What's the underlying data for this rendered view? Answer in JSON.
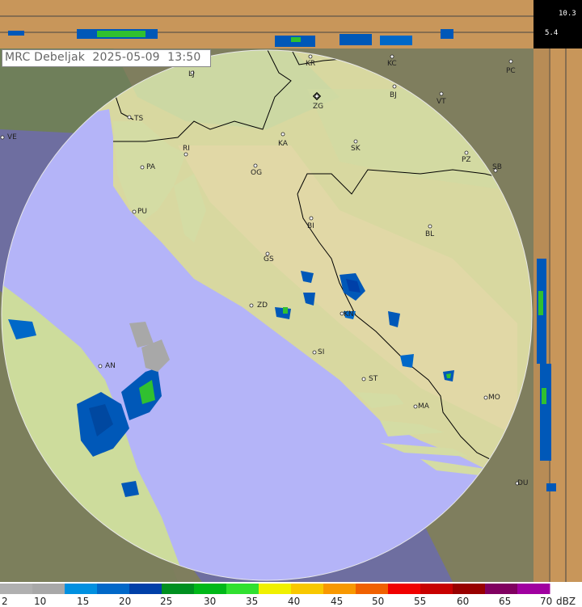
{
  "header": {
    "station": "MRC Debeljak",
    "date": "2025-05-09",
    "time": "13:50"
  },
  "height_scale": {
    "top_value": "10.3",
    "mid_value": "5.4"
  },
  "cities": [
    {
      "code": "LJ"
    },
    {
      "code": "KR"
    },
    {
      "code": "KC"
    },
    {
      "code": "PC"
    },
    {
      "code": "ZG"
    },
    {
      "code": "BJ"
    },
    {
      "code": "VT"
    },
    {
      "code": "TS"
    },
    {
      "code": "VE"
    },
    {
      "code": "KA"
    },
    {
      "code": "SK"
    },
    {
      "code": "RI"
    },
    {
      "code": "PA"
    },
    {
      "code": "OG"
    },
    {
      "code": "PZ"
    },
    {
      "code": "SB"
    },
    {
      "code": "PU"
    },
    {
      "code": "BI"
    },
    {
      "code": "BL"
    },
    {
      "code": "GS"
    },
    {
      "code": "ZD"
    },
    {
      "code": "KN"
    },
    {
      "code": "AN"
    },
    {
      "code": "SI"
    },
    {
      "code": "ST"
    },
    {
      "code": "MO"
    },
    {
      "code": "MA"
    },
    {
      "code": "DU"
    }
  ],
  "legend": {
    "unit": "dBZ",
    "labels": [
      "2",
      "10",
      "15",
      "20",
      "25",
      "30",
      "35",
      "40",
      "45",
      "50",
      "55",
      "60",
      "65",
      "70"
    ],
    "colors": [
      "#b0b0b0",
      "#a8a8a8",
      "#0090e0",
      "#0068c8",
      "#0040a8",
      "#009020",
      "#00b818",
      "#30e030",
      "#f0f000",
      "#f8c800",
      "#f89800",
      "#f06000",
      "#f00000",
      "#c80000",
      "#980000",
      "#800060",
      "#a000a0"
    ]
  },
  "map_colors": {
    "sea": "#b4b4f8",
    "land": "#d8d8a0",
    "outside_range": "#8c8c70",
    "border": "#000000",
    "strip": "#c8965a"
  }
}
